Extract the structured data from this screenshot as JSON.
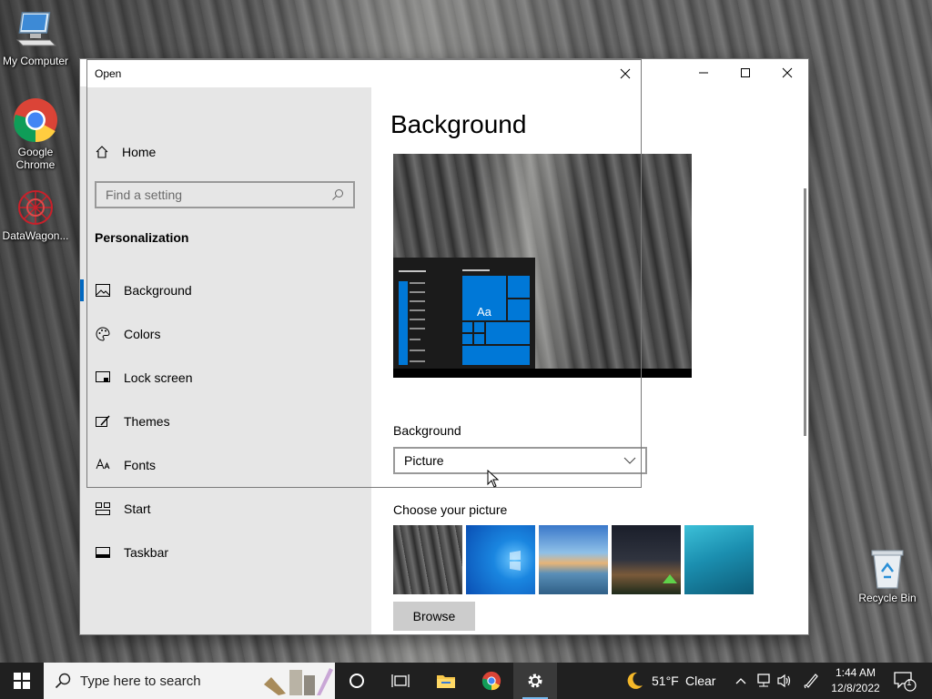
{
  "desktop": {
    "icons": [
      {
        "label": "My Computer"
      },
      {
        "label": "Google Chrome"
      },
      {
        "label": "DataWagon..."
      },
      {
        "label": "Recycle Bin"
      }
    ]
  },
  "open_dialog": {
    "title": "Open"
  },
  "settings": {
    "sidebar": {
      "home_label": "Home",
      "search_placeholder": "Find a setting",
      "section_title": "Personalization",
      "items": [
        {
          "label": "Background",
          "icon": "picture-icon",
          "active": true
        },
        {
          "label": "Colors",
          "icon": "palette-icon"
        },
        {
          "label": "Lock screen",
          "icon": "lock-screen-icon"
        },
        {
          "label": "Themes",
          "icon": "themes-brush-icon"
        },
        {
          "label": "Fonts",
          "icon": "fonts-icon"
        },
        {
          "label": "Start",
          "icon": "start-icon"
        },
        {
          "label": "Taskbar",
          "icon": "taskbar-icon"
        }
      ]
    },
    "main": {
      "title": "Background",
      "preview_sample": "Aa",
      "background_label": "Background",
      "background_value": "Picture",
      "choose_label": "Choose your picture",
      "browse_label": "Browse",
      "accent_color": "#0078d7"
    }
  },
  "taskbar": {
    "search_placeholder": "Type here to search",
    "weather_temp": "51°F",
    "weather_desc": "Clear",
    "time": "1:44 AM",
    "date": "12/8/2022",
    "notification_count": "1"
  }
}
